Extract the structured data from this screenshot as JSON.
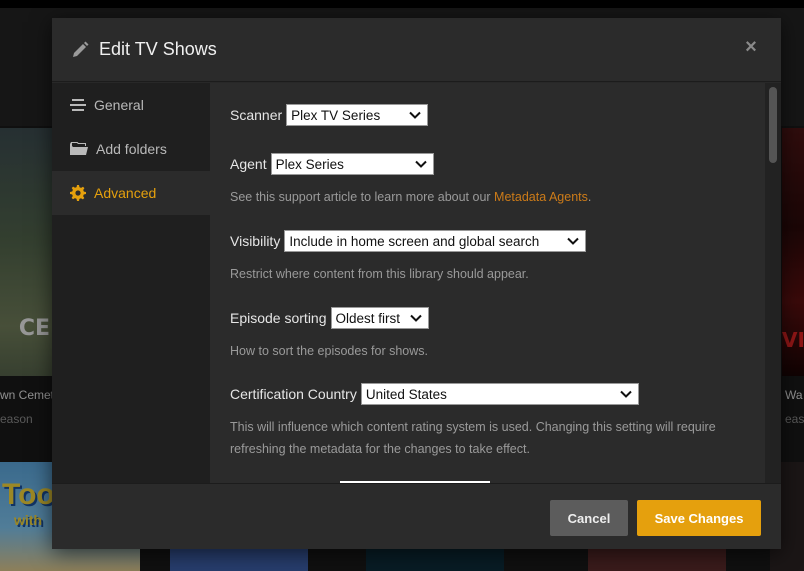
{
  "background": {
    "left_caption": "wn Cemet",
    "left_sub": "eason",
    "left_poster_text": "CE",
    "right_caption": "Wa",
    "right_sub": "eason",
    "right_poster_text": "VI",
    "bottom_left_poster_text": "Too",
    "bottom_left_poster_sub": "with"
  },
  "modal": {
    "title": "Edit TV Shows",
    "close_label": "×"
  },
  "sidebar": {
    "items": [
      {
        "label": "General",
        "icon": "list-icon"
      },
      {
        "label": "Add folders",
        "icon": "folder-icon"
      },
      {
        "label": "Advanced",
        "icon": "gear-icon",
        "active": true
      }
    ]
  },
  "settings": {
    "scanner": {
      "label": "Scanner",
      "value": "Plex TV Series"
    },
    "agent": {
      "label": "Agent",
      "value": "Plex Series",
      "help_prefix": "See this support article to learn more about our ",
      "help_link": "Metadata Agents",
      "help_suffix": "."
    },
    "visibility": {
      "label": "Visibility",
      "value": "Include in home screen and global search",
      "help": "Restrict where content from this library should appear."
    },
    "episode_sorting": {
      "label": "Episode sorting",
      "value": "Oldest first",
      "help": "How to sort the episodes for shows."
    },
    "certification_country": {
      "label": "Certification Country",
      "value": "United States",
      "help_line1": "This will influence which content rating system is used. Changing this setting will require",
      "help_line2": "refreshing the metadata for the changes to take effect."
    }
  },
  "footer": {
    "cancel_label": "Cancel",
    "save_label": "Save Changes"
  },
  "colors": {
    "accent": "#e5a00d",
    "link": "#cc7b19",
    "modal_bg": "#282828"
  }
}
